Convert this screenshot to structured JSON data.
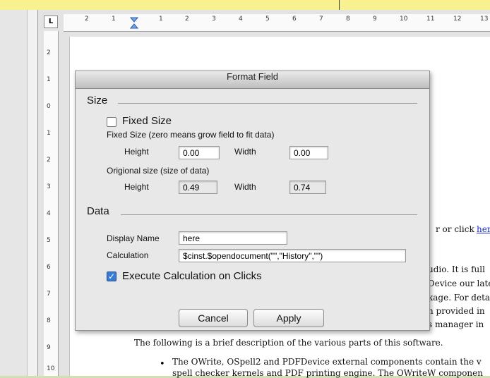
{
  "dialog": {
    "title": "Format Field",
    "size_section": {
      "title": "Size",
      "fixed_size_label": "Fixed Size",
      "fixed_size_checked": false,
      "fixed_size_hint": "Fixed Size (zero means grow field to fit data)",
      "height_label": "Height",
      "height_value": "0.00",
      "width_label": "Width",
      "width_value": "0.00",
      "original_size_label": "Origional size (size of data)",
      "orig_height_label": "Height",
      "orig_height_value": "0.49",
      "orig_width_label": "Width",
      "orig_width_value": "0.74"
    },
    "data_section": {
      "title": "Data",
      "display_name_label": "Display Name",
      "display_name_value": "here",
      "calculation_label": "Calculation",
      "calculation_value": "$cinst.$opendocument(\"\",\"History\",\"\")",
      "execute_label": "Execute Calculation on Clicks",
      "execute_checked": true
    },
    "buttons": {
      "cancel": "Cancel",
      "apply": "Apply"
    }
  },
  "ruler": {
    "corner": "L",
    "h_ticks": [
      "2",
      "1",
      "1",
      "2",
      "3",
      "4",
      "5",
      "6",
      "7",
      "8",
      "9",
      "10",
      "11",
      "12",
      "13"
    ],
    "v_ticks": [
      "2",
      "1",
      "0",
      "1",
      "2",
      "3",
      "4",
      "5",
      "6",
      "7",
      "8",
      "9",
      "10"
    ]
  },
  "document": {
    "fragment1": "r or click ",
    "fragment1_link": "here",
    "line_a": "udio. It is full",
    "line_b": "Device our late",
    "line_c": "kage. For deta",
    "line_d": "n provided in",
    "line_e": "s manager in",
    "para1": "The following is a brief description of the various parts of this software.",
    "bullet": "•",
    "bullet_line1": "The OWrite, OSpell2 and PDFDevice external components contain the v",
    "bullet_line2": "spell checker kernels and PDF printing engine. The OWriteW componen"
  }
}
